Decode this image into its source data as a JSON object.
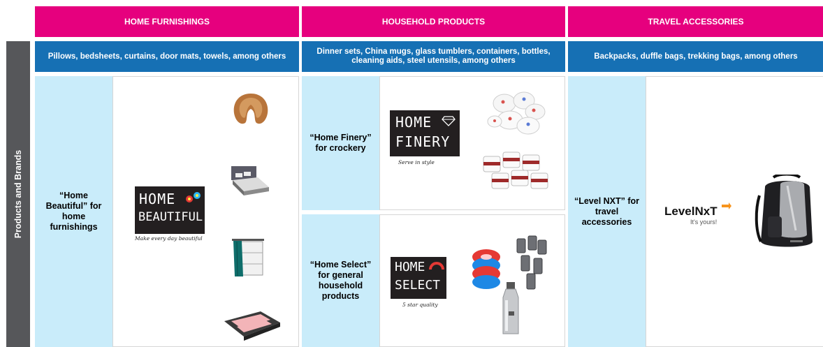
{
  "side_label": "Products and Brands",
  "columns": [
    {
      "header": "HOME FURNISHINGS",
      "subheader": "Pillows, bedsheets, curtains, door mats, towels, among others",
      "brand_label": "“Home Beautiful” for home furnishings",
      "logo": {
        "line1": "HOME",
        "line2": "BEAUTIFUL",
        "tagline": "Make every day beautiful"
      },
      "product_icons": [
        "neck-pillow-icon",
        "bed-icon",
        "curtain-icon",
        "door-mat-icon"
      ]
    },
    {
      "header": "HOUSEHOLD PRODUCTS",
      "subheader": "Dinner sets, China mugs, glass tumblers, containers, bottles, cleaning aids, steel utensils, among others",
      "brands": [
        {
          "label": "“Home Finery” for crockery",
          "logo": {
            "line1": "HOME",
            "line2": "FINERY",
            "tagline": "Serve in style"
          },
          "product_icons": [
            "dinner-set-icon",
            "mugs-icon"
          ]
        },
        {
          "label": "“Home Select” for general household products",
          "logo": {
            "line1": "HOME",
            "line2": "SELECT",
            "tagline": "5 star quality"
          },
          "product_icons": [
            "scrub-pads-icon",
            "tumblers-icon",
            "steel-bottle-icon"
          ]
        }
      ]
    },
    {
      "header": "TRAVEL ACCESSORIES",
      "subheader": "Backpacks, duffle bags, trekking bags, among others",
      "brand_label": "“Level NXT” for travel accessories",
      "logo": {
        "name": "LevelNxT",
        "tagline": "It's yours!"
      },
      "product_icons": [
        "backpack-icon"
      ]
    }
  ],
  "colors": {
    "header": "#e6007e",
    "subheader": "#1670b4",
    "label_bg": "#c9ecfa",
    "side": "#56575a"
  }
}
